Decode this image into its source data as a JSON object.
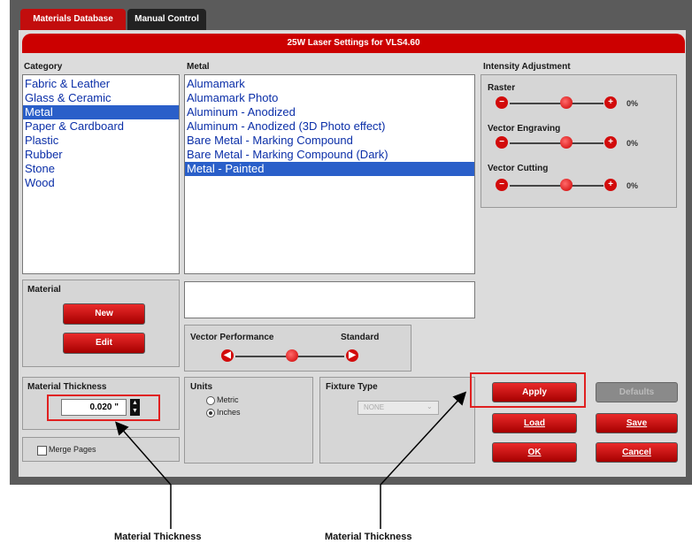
{
  "tabs": [
    {
      "label": "Materials Database"
    },
    {
      "label": "Manual Control"
    }
  ],
  "title": "25W Laser Settings for VLS4.60",
  "category": {
    "header": "Category",
    "items": [
      "Fabric & Leather",
      "Glass & Ceramic",
      "Metal",
      "Paper & Cardboard",
      "Plastic",
      "Rubber",
      "Stone",
      "Wood"
    ],
    "selected": "Metal"
  },
  "metal": {
    "header": "Metal",
    "items": [
      "Alumamark",
      "Alumamark Photo",
      "Aluminum - Anodized",
      "Aluminum - Anodized (3D Photo effect)",
      "Bare Metal - Marking Compound",
      "Bare Metal - Marking Compound (Dark)",
      "Metal - Painted"
    ],
    "selected": "Metal - Painted"
  },
  "intensity": {
    "header": "Intensity Adjustment",
    "sliders": [
      {
        "label": "Raster",
        "value": "0%"
      },
      {
        "label": "Vector Engraving",
        "value": "0%"
      },
      {
        "label": "Vector Cutting",
        "value": "0%"
      }
    ]
  },
  "material": {
    "header": "Material",
    "new_label": "New",
    "edit_label": "Edit"
  },
  "vector_performance": {
    "label": "Vector Performance",
    "value": "Standard"
  },
  "material_thickness": {
    "header": "Material Thickness",
    "value": "0.020 \""
  },
  "merge_pages": {
    "label": "Merge Pages"
  },
  "units": {
    "header": "Units",
    "options": [
      "Metric",
      "Inches"
    ],
    "selected": "Inches"
  },
  "fixture": {
    "header": "Fixture Type",
    "value": "NONE"
  },
  "buttons": {
    "apply": "Apply",
    "defaults": "Defaults",
    "load": "Load",
    "save": "Save",
    "ok": "OK",
    "cancel": "Cancel"
  },
  "annotations": [
    "Material Thickness",
    "Material Thickness"
  ],
  "colors": {
    "accent": "#c00000",
    "selection": "#2a5fc9",
    "link_text": "#0b2fa8",
    "highlight_box": "#e02020"
  }
}
